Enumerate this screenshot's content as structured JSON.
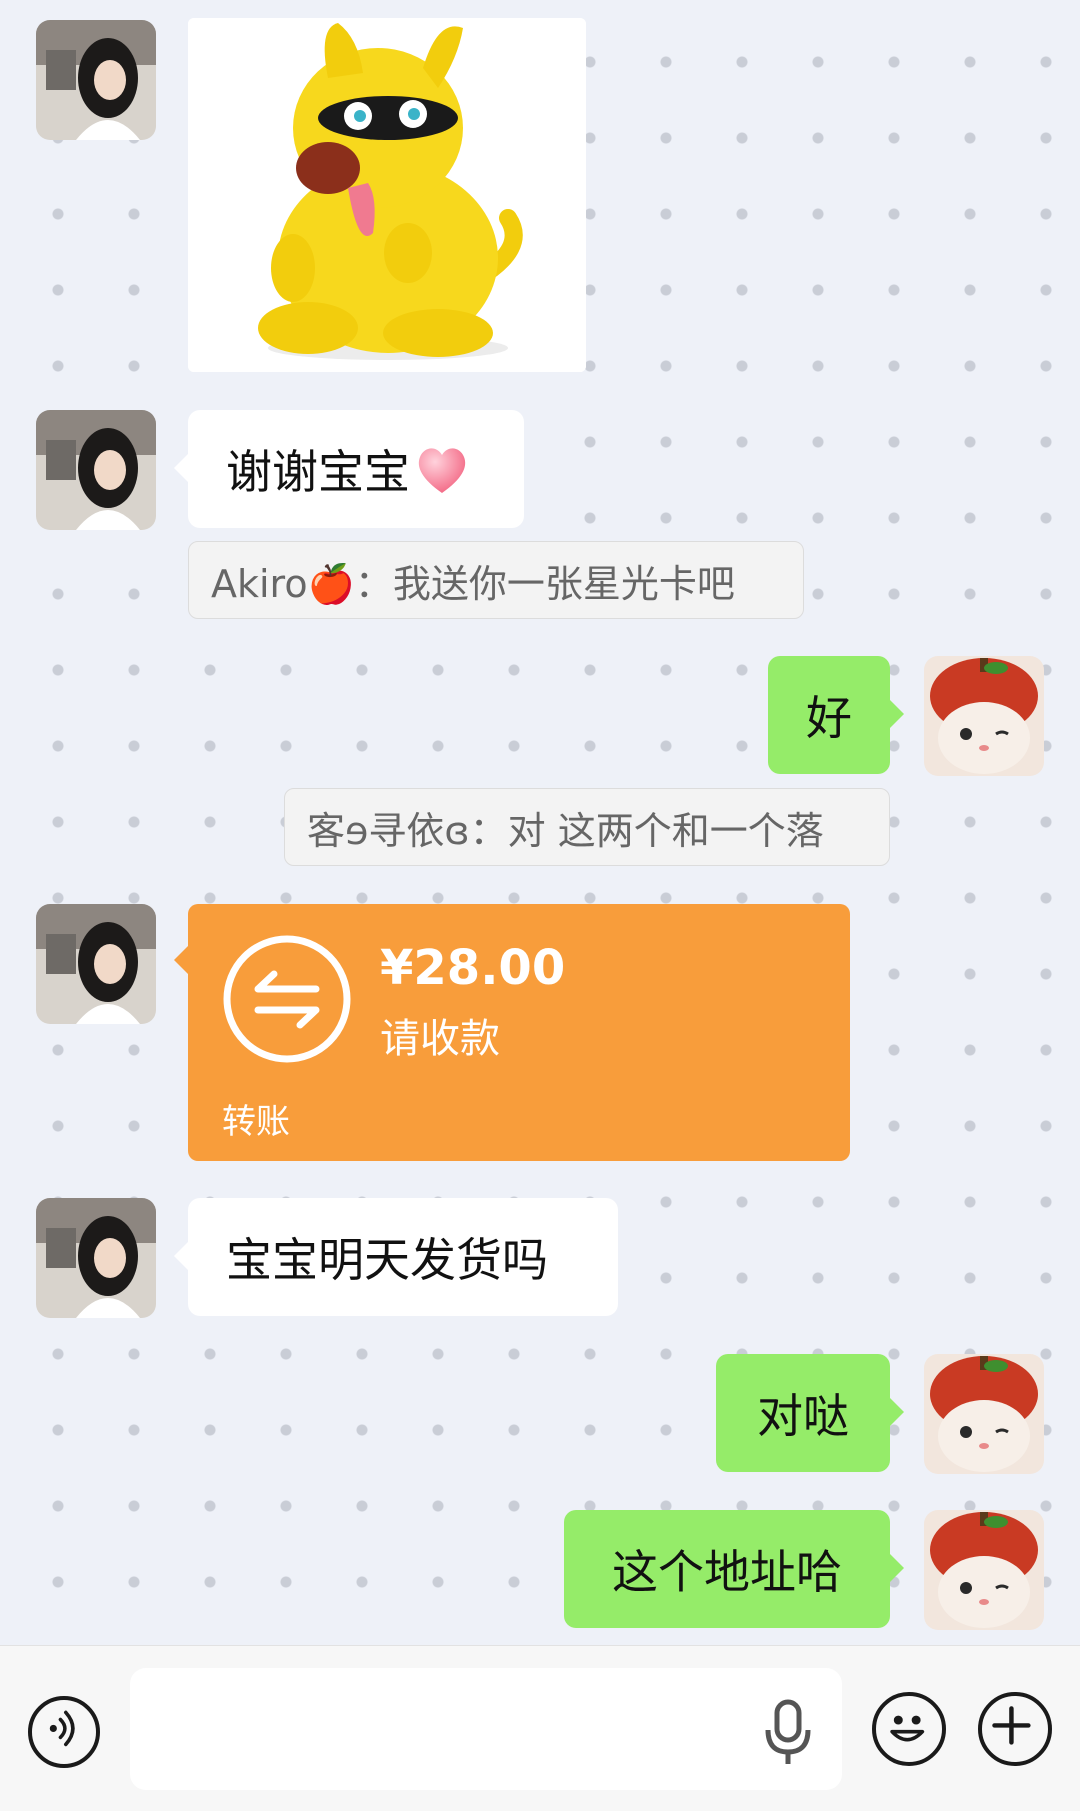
{
  "messages": {
    "m1": {
      "sender": "other",
      "type": "sticker",
      "icon": "yellow-dog-sticker-icon"
    },
    "m2": {
      "sender": "other",
      "text": "谢谢宝宝",
      "emoji": "❤️"
    },
    "q1": {
      "text": "Akiro🍎：我送你一张星光卡吧"
    },
    "m3": {
      "sender": "me",
      "text": "好"
    },
    "q2": {
      "text": "客ɘ寻依ɞ：对 这两个和一个落"
    },
    "m4": {
      "sender": "other",
      "type": "transfer",
      "amount": "¥28.00",
      "status": "请收款",
      "label": "转账",
      "color": "#f89d3b"
    },
    "m5": {
      "sender": "other",
      "text": "宝宝明天发货吗"
    },
    "m6": {
      "sender": "me",
      "text": "对哒"
    },
    "m7": {
      "sender": "me",
      "text": "这个地址哈"
    }
  },
  "input": {
    "placeholder": ""
  },
  "icons": [
    "voice-icon",
    "mic-icon",
    "emoji-icon",
    "plus-icon"
  ],
  "colors": {
    "my_bubble": "#95ec69",
    "other_bubble": "#ffffff",
    "transfer": "#f89d3b",
    "background": "#eef1f8"
  }
}
